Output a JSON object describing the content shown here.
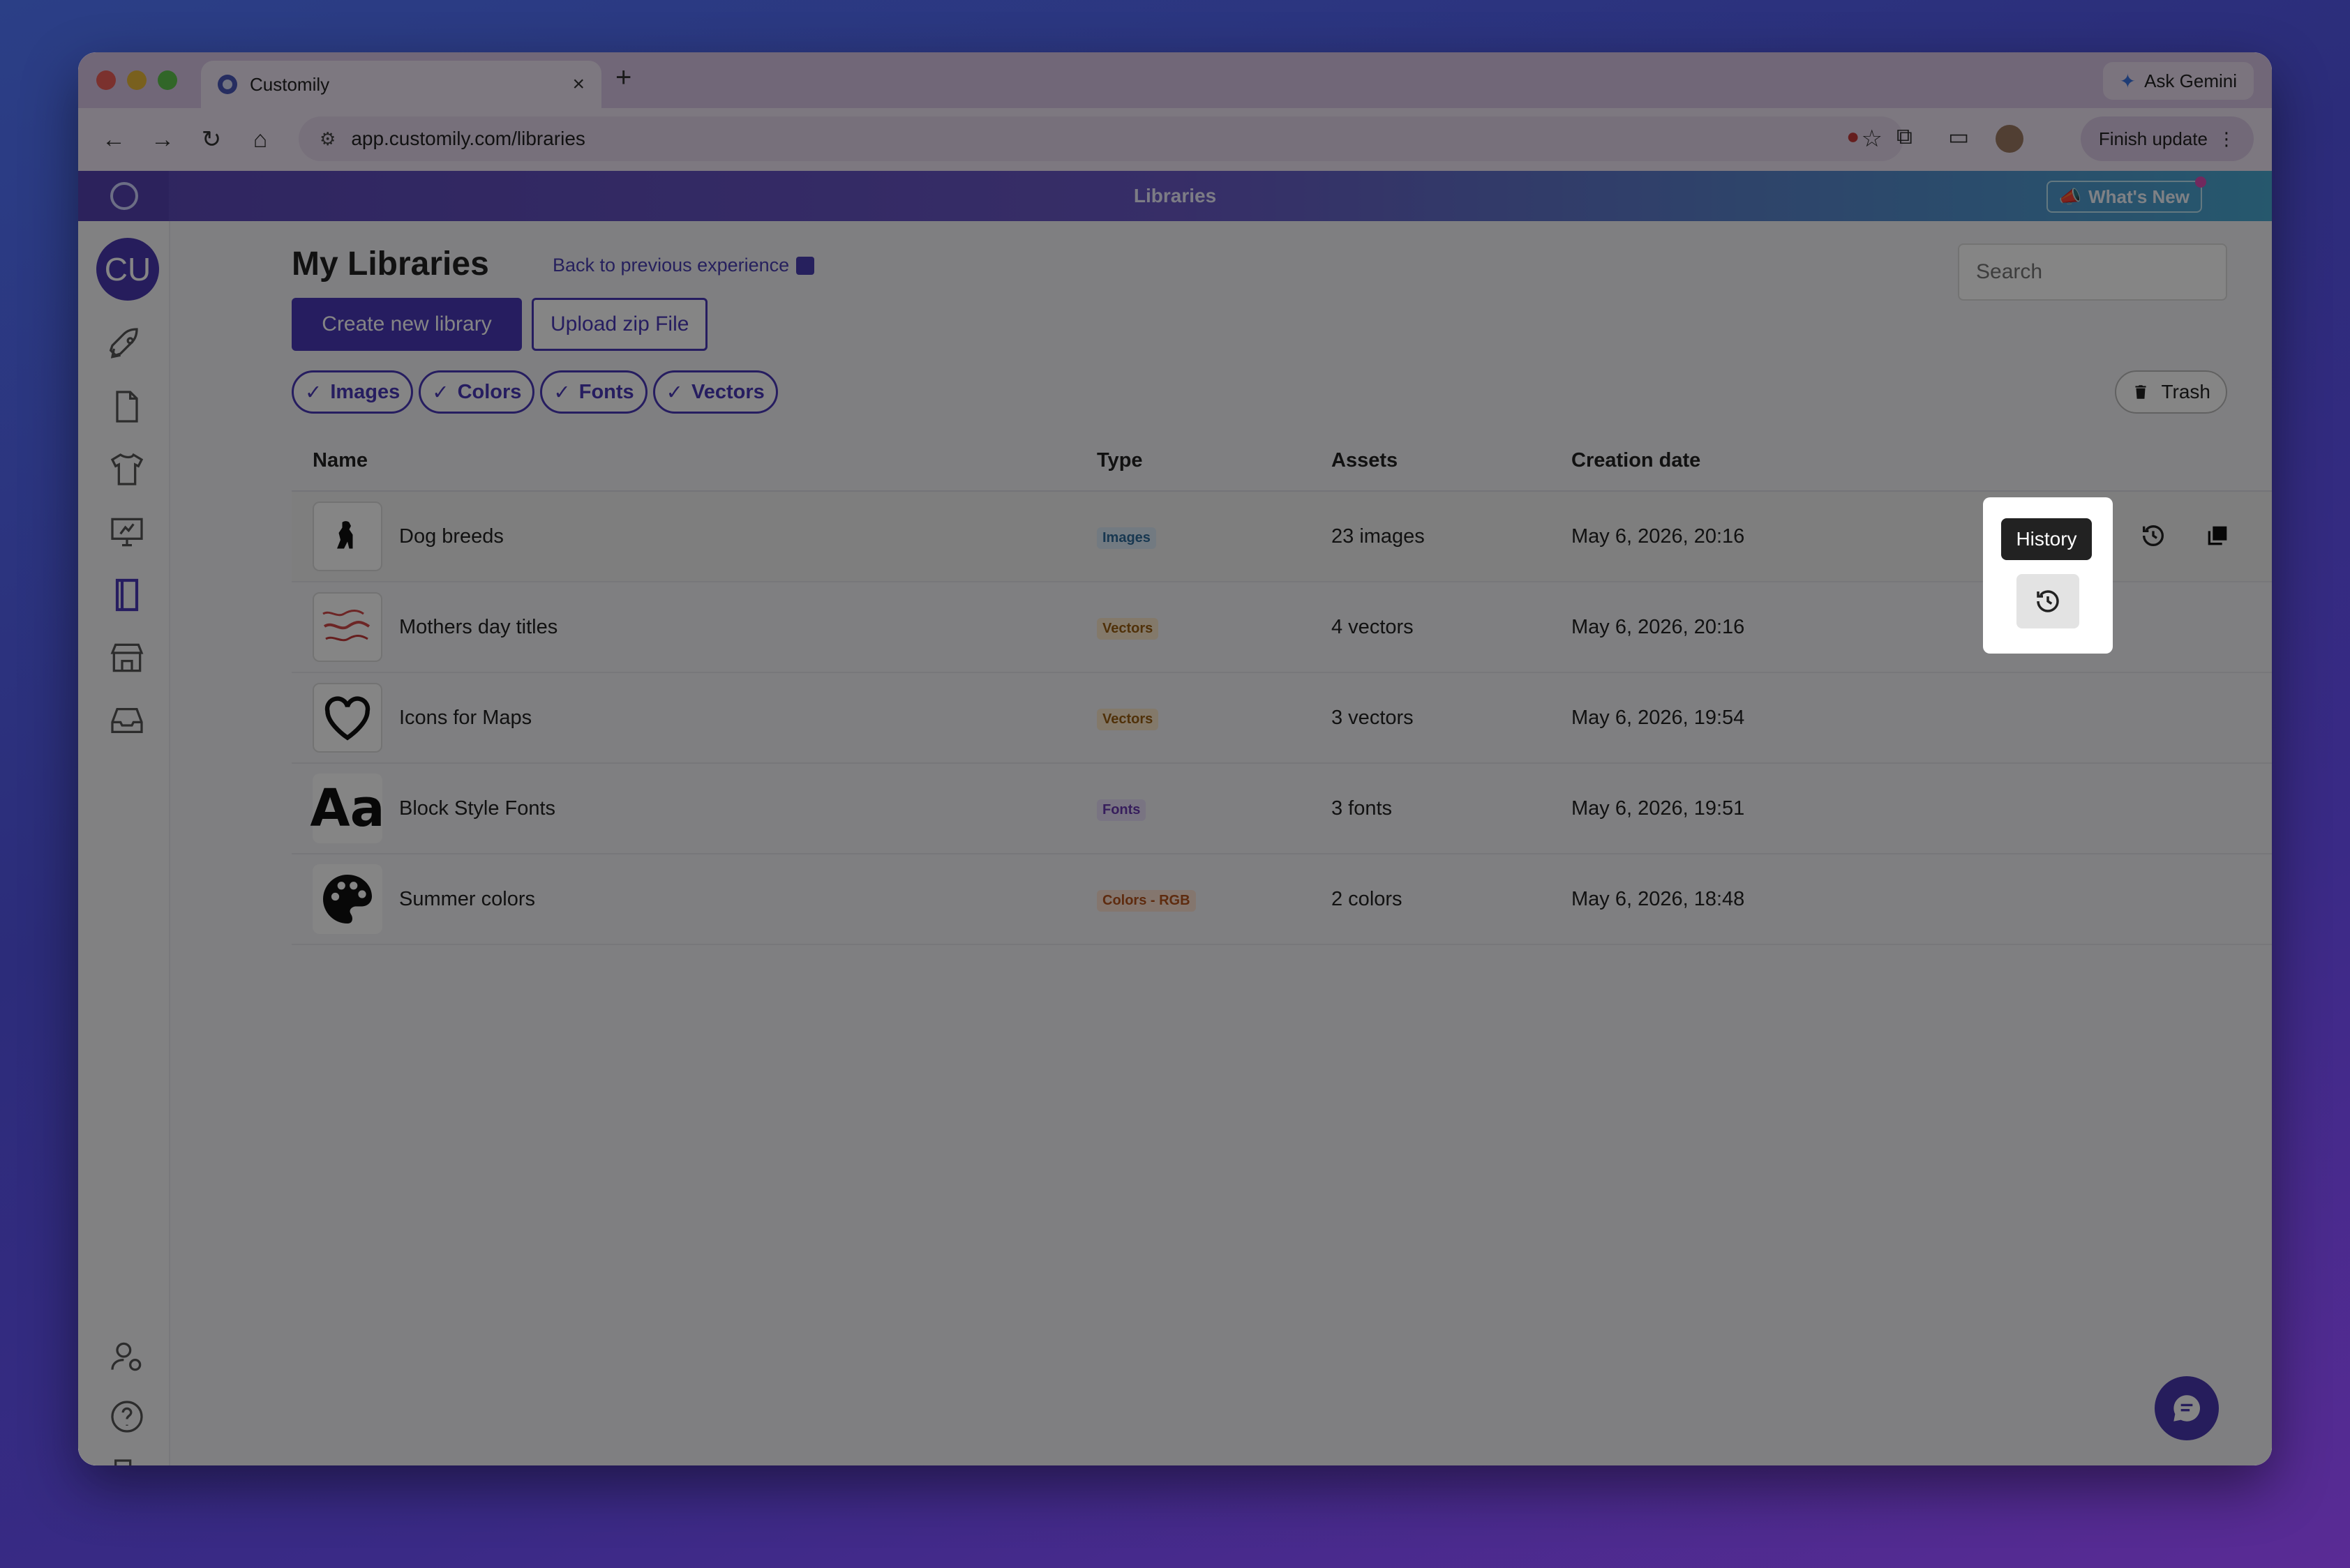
{
  "browser": {
    "tab_title": "Customily",
    "tab_close": "×",
    "new_tab": "+",
    "gemini_label": "Ask Gemini",
    "url": "app.customily.com/libraries",
    "finish_update": "Finish update"
  },
  "app": {
    "header_title": "Libraries",
    "whats_new": "What's New",
    "avatar_initials": "CU"
  },
  "page": {
    "title": "My Libraries",
    "back_link": "Back to previous experience",
    "search_placeholder": "Search",
    "create_button": "Create new library",
    "upload_button": "Upload zip File",
    "trash_button": "Trash",
    "filters": [
      "Images",
      "Colors",
      "Fonts",
      "Vectors"
    ]
  },
  "table": {
    "headers": {
      "name": "Name",
      "type": "Type",
      "assets": "Assets",
      "date": "Creation date"
    },
    "rows": [
      {
        "name": "Dog breeds",
        "type": "Images",
        "assets": "23 images",
        "date": "May 6, 2026, 20:16"
      },
      {
        "name": "Mothers day titles",
        "type": "Vectors",
        "assets": "4 vectors",
        "date": "May 6, 2026, 20:16"
      },
      {
        "name": "Icons for Maps",
        "type": "Vectors",
        "assets": "3 vectors",
        "date": "May 6, 2026, 19:54"
      },
      {
        "name": "Block Style Fonts",
        "type": "Fonts",
        "assets": "3 fonts",
        "date": "May 6, 2026, 19:51"
      },
      {
        "name": "Summer colors",
        "type": "Colors - RGB",
        "assets": "2 colors",
        "date": "May 6, 2026, 18:48"
      }
    ]
  },
  "tooltip": {
    "label": "History"
  },
  "font_thumb": "Aa",
  "colors": {
    "accent": "#4a38b8",
    "tab_bar": "#d9c6e6"
  }
}
